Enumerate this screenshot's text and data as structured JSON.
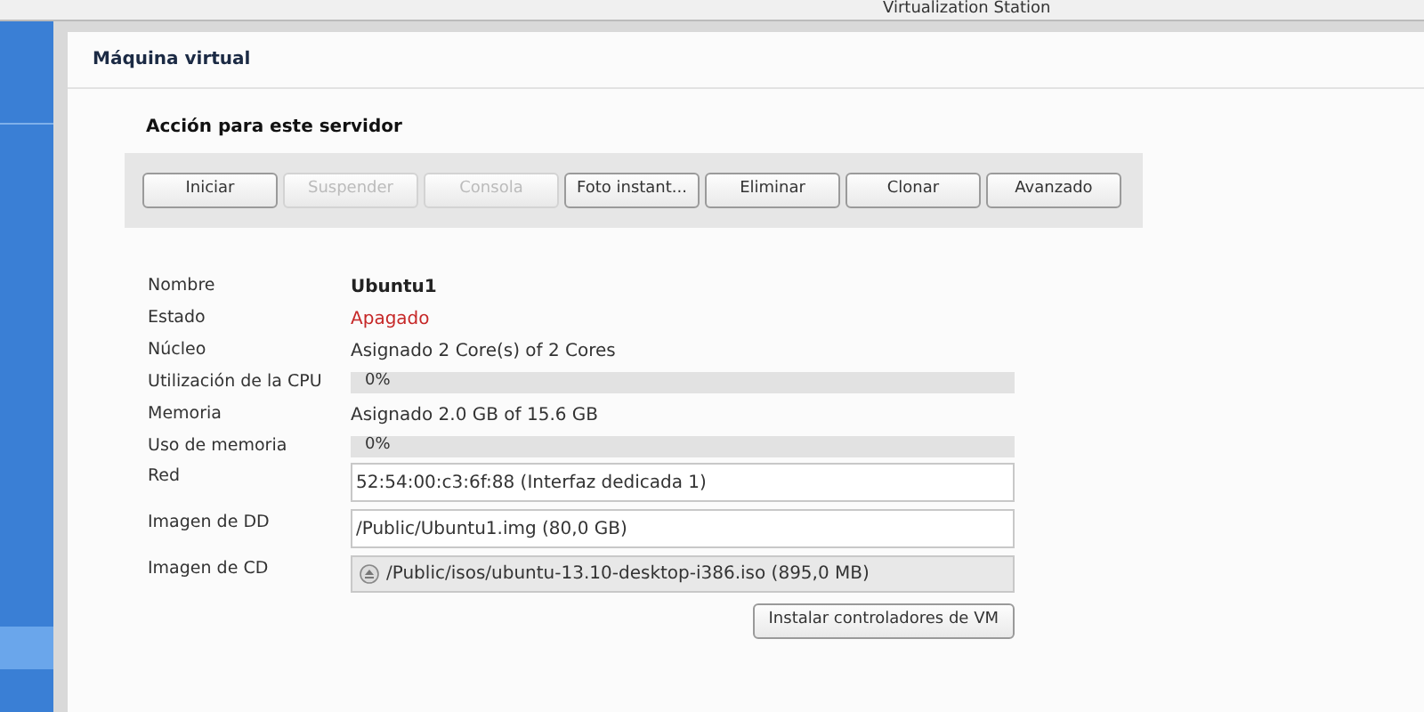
{
  "top_bar": {
    "title": "Virtualization Station"
  },
  "panel": {
    "title": "Máquina virtual"
  },
  "actions": {
    "title": "Acción para este servidor",
    "buttons": [
      {
        "label": "Iniciar",
        "disabled": false
      },
      {
        "label": "Suspender",
        "disabled": true
      },
      {
        "label": "Consola",
        "disabled": true
      },
      {
        "label": "Foto instant...",
        "disabled": false
      },
      {
        "label": "Eliminar",
        "disabled": false
      },
      {
        "label": "Clonar",
        "disabled": false
      },
      {
        "label": "Avanzado",
        "disabled": false
      }
    ]
  },
  "details": [
    {
      "kind": "name",
      "label": "Nombre",
      "value": "Ubuntu1"
    },
    {
      "kind": "status",
      "label": "Estado",
      "value": "Apagado",
      "color": "#c62828"
    },
    {
      "kind": "text",
      "label": "Núcleo",
      "value": "Asignado 2 Core(s) of 2 Cores"
    },
    {
      "kind": "bar",
      "label": "Utilización de la CPU",
      "value": "0%",
      "level": 0
    },
    {
      "kind": "text",
      "label": "Memoria",
      "value": "Asignado 2.0 GB of 15.6 GB"
    },
    {
      "kind": "bar",
      "label": "Uso de memoria",
      "value": "0%",
      "level": 0
    },
    {
      "kind": "field",
      "label": "Red",
      "value": "52:54:00:c3:6f:88 (Interfaz dedicada 1)"
    },
    {
      "kind": "field",
      "label": "Imagen de DD",
      "value": "/Public/Ubuntu1.img (80,0 GB)"
    },
    {
      "kind": "disc",
      "label": "Imagen de CD",
      "value": "/Public/isos/ubuntu-13.10-desktop-i386.iso (895,0 MB)"
    }
  ],
  "install_button": "Instalar controladores de VM"
}
